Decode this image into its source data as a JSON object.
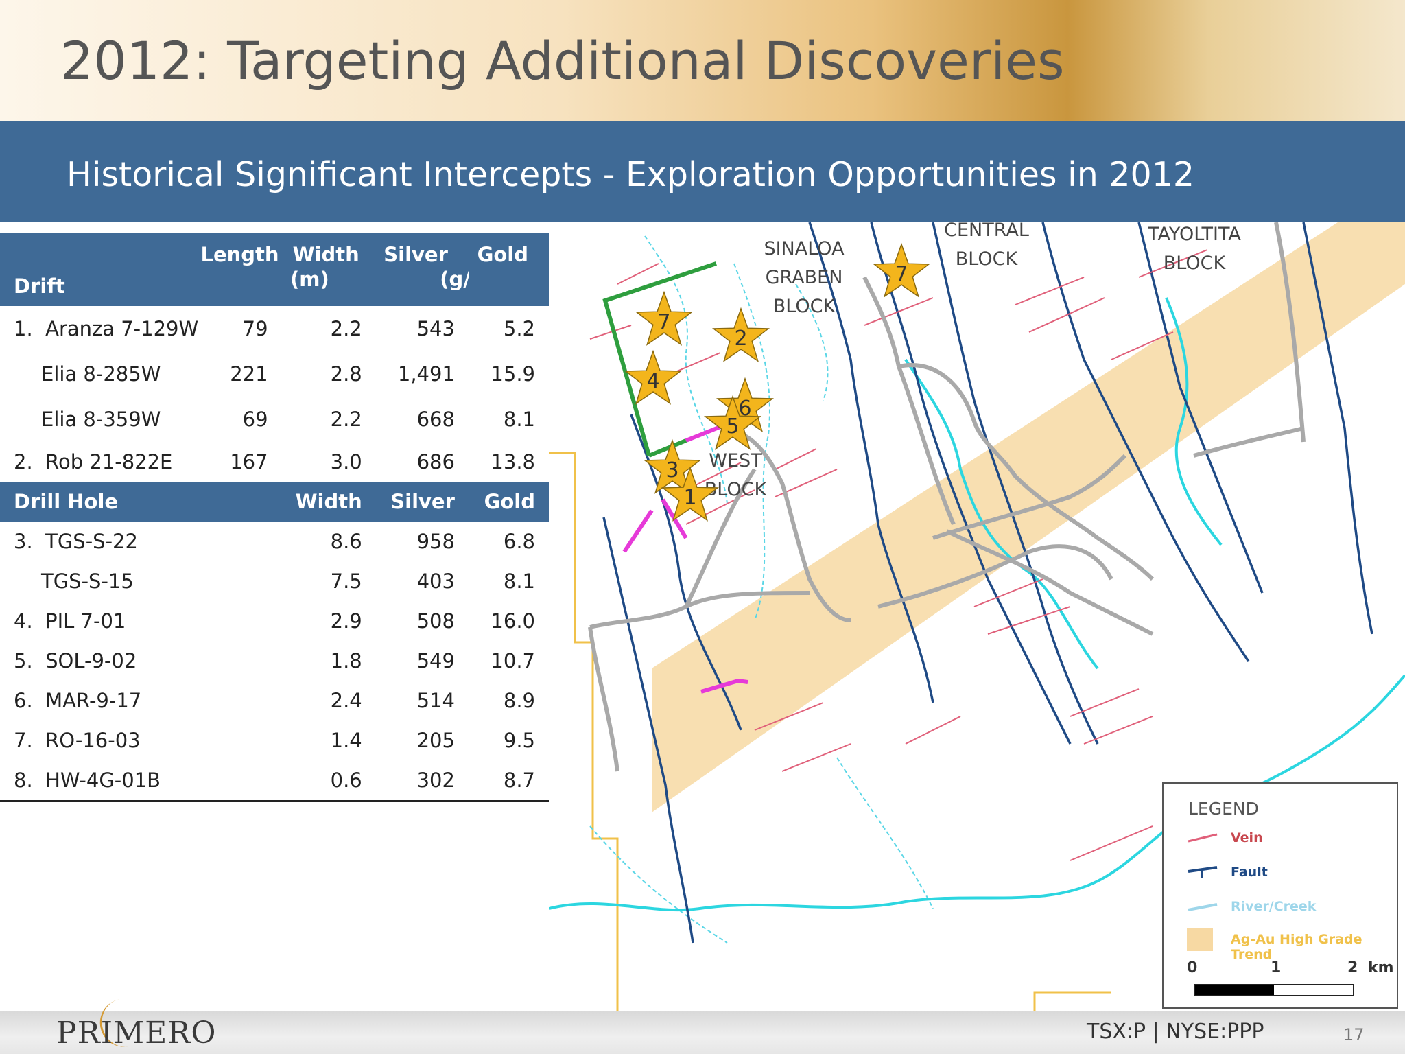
{
  "title": "2012: Targeting Additional Discoveries",
  "subtitle": "Historical Significant Intercepts - Exploration Opportunities in 2012",
  "drift_header": {
    "name": "Drift",
    "length": "Length",
    "width": "Width",
    "unit_m": "(m)",
    "silver": "Silver",
    "gold": "Gold",
    "unit_gt": "(g/t)"
  },
  "drift_rows": [
    {
      "num": "1.",
      "name": "Aranza 7-129W",
      "length": "79",
      "width": "2.2",
      "silver": "543",
      "gold": "5.2"
    },
    {
      "num": "",
      "name": "Elia 8-285W",
      "length": "221",
      "width": "2.8",
      "silver": "1,491",
      "gold": "15.9"
    },
    {
      "num": "",
      "name": "Elia 8-359W",
      "length": "69",
      "width": "2.2",
      "silver": "668",
      "gold": "8.1"
    },
    {
      "num": "2.",
      "name": "Rob 21-822E",
      "length": "167",
      "width": "3.0",
      "silver": "686",
      "gold": "13.8"
    }
  ],
  "hole_header": {
    "name": "Drill Hole",
    "width": "Width",
    "silver": "Silver",
    "gold": "Gold"
  },
  "hole_rows": [
    {
      "num": "3.",
      "name": "TGS-S-22",
      "width": "8.6",
      "silver": "958",
      "gold": "6.8"
    },
    {
      "num": "",
      "name": "TGS-S-15",
      "width": "7.5",
      "silver": "403",
      "gold": "8.1"
    },
    {
      "num": "4.",
      "name": "PIL 7-01",
      "width": "2.9",
      "silver": "508",
      "gold": "16.0"
    },
    {
      "num": "5.",
      "name": "SOL-9-02",
      "width": "1.8",
      "silver": "549",
      "gold": "10.7"
    },
    {
      "num": "6.",
      "name": "MAR-9-17",
      "width": "2.4",
      "silver": "514",
      "gold": "8.9"
    },
    {
      "num": "7.",
      "name": "RO-16-03",
      "width": "1.4",
      "silver": "205",
      "gold": "9.5"
    },
    {
      "num": "8.",
      "name": "HW-4G-01B",
      "width": "0.6",
      "silver": "302",
      "gold": "8.7"
    }
  ],
  "map": {
    "blocks": {
      "sinaloa": [
        "SINALOA",
        "GRABEN",
        "BLOCK"
      ],
      "central": [
        "CENTRAL",
        "BLOCK"
      ],
      "tayoltita": [
        "TAYOLTITA",
        "BLOCK"
      ],
      "west": [
        "WEST",
        "BLOCK"
      ]
    },
    "stars": [
      "7",
      "7",
      "2",
      "4",
      "6",
      "5",
      "3",
      "1"
    ]
  },
  "legend": {
    "title": "LEGEND",
    "vein": "Vein",
    "fault": "Fault",
    "river": "River/Creek",
    "trend": "Ag-Au High Grade Trend",
    "scale_0": "0",
    "scale_1": "1",
    "scale_2": "2",
    "scale_unit": "km"
  },
  "footer": {
    "logo": "PRIMERO",
    "ticker": "TSX:P  |  NYSE:PPP",
    "page": "17"
  },
  "colors": {
    "band": "#3f6a96",
    "vein": "#e0607a",
    "fault": "#1f4a85",
    "river": "#5ad6e6",
    "trend": "#f7d9a3",
    "star": "#f3b51c",
    "green_line": "#2e9e3e",
    "magenta_line": "#e63ad8",
    "road": "#a9a9a9",
    "border": "#f0c14a"
  }
}
